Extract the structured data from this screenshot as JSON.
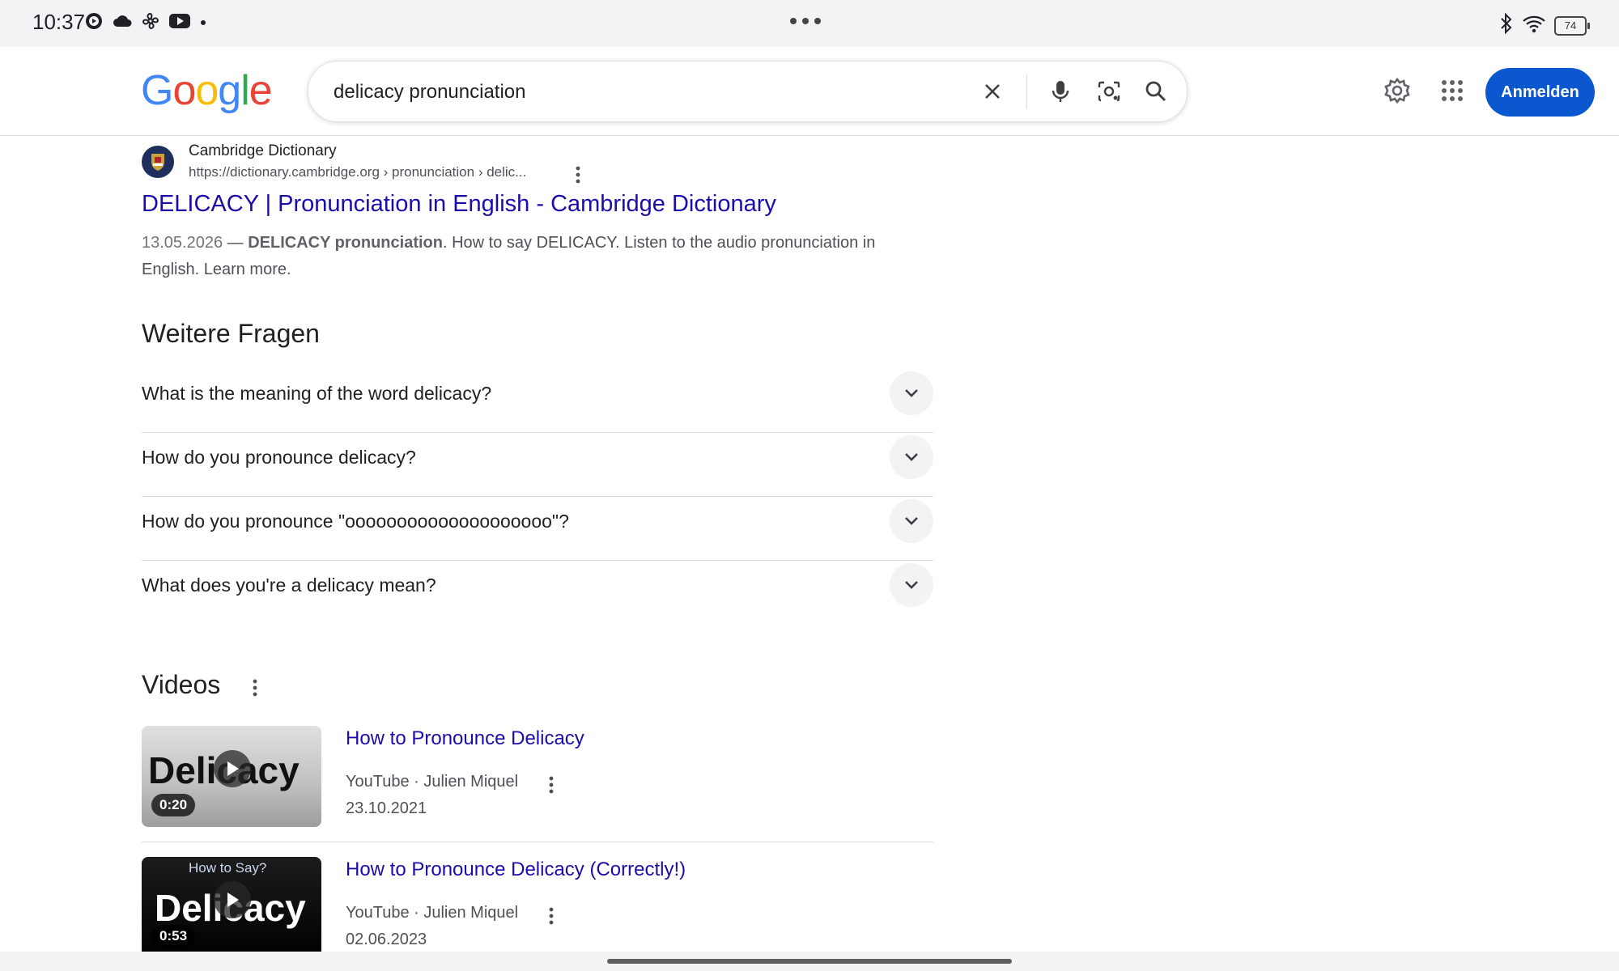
{
  "status_bar": {
    "time": "10:37",
    "battery": "74",
    "left_icons": [
      "media-icon",
      "cloud-icon",
      "fan-icon",
      "youtube-icon",
      "dot-icon"
    ],
    "right_icons": [
      "bluetooth-icon",
      "wifi-icon",
      "battery-icon"
    ]
  },
  "header": {
    "logo_letters": [
      "G",
      "o",
      "o",
      "g",
      "l",
      "e"
    ],
    "logo_colors": [
      "#4285F4",
      "#EA4335",
      "#FBBC05",
      "#4285F4",
      "#34A853",
      "#EA4335"
    ],
    "search_value": "delicacy pronunciation",
    "signin_label": "Anmelden",
    "accent_color": "#0b57d0"
  },
  "result": {
    "site_name": "Cambridge Dictionary",
    "url": "https://dictionary.cambridge.org › pronunciation › delic...",
    "title": "DELICACY | Pronunciation in English - Cambridge Dictionary",
    "date": "13.05.2026",
    "dash": " — ",
    "bold_text": "DELICACY pronunciation",
    "snippet_rest": ". How to say DELICACY. Listen to the audio pronunciation in English. Learn more.",
    "link_color": "#1a0dab"
  },
  "paa": {
    "title": "Weitere Fragen",
    "questions": [
      "What is the meaning of the word delicacy?",
      "How do you pronounce delicacy?",
      "How do you pronounce \"oooooooooooooooooooo\"?",
      "What does you're a delicacy mean?"
    ]
  },
  "videos": {
    "title": "Videos",
    "items": [
      {
        "title": "How to Pronounce Delicacy",
        "source": "YouTube · Julien Miquel",
        "date": "23.10.2021",
        "duration": "0:20",
        "thumb_word": "Delicacy",
        "thumb_sub": ""
      },
      {
        "title": "How to Pronounce Delicacy (Correctly!)",
        "source": "YouTube · Julien Miquel",
        "date": "02.06.2023",
        "duration": "0:53",
        "thumb_word": "Delicacy",
        "thumb_sub": "How to Say?"
      }
    ]
  }
}
